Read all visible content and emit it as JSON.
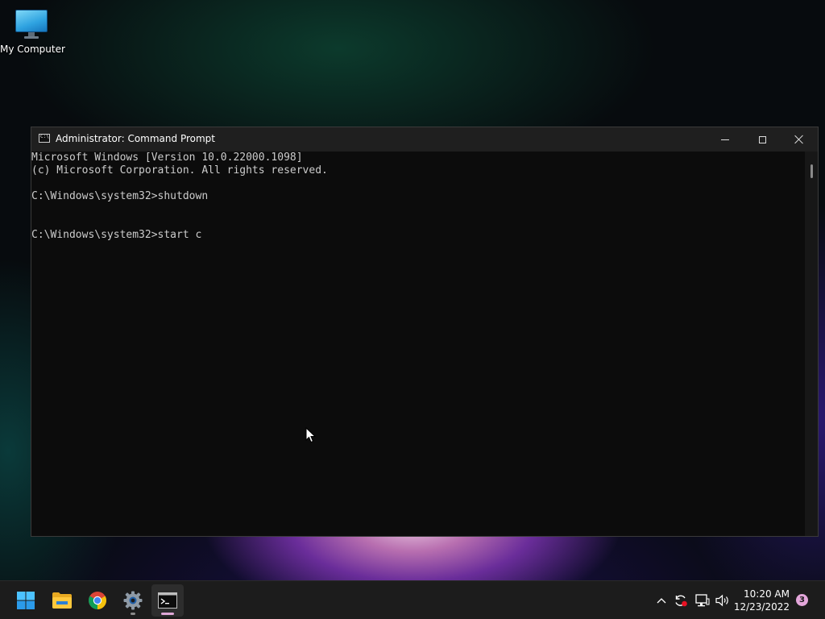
{
  "desktop": {
    "icons": [
      {
        "label": "My Computer",
        "icon": "monitor-icon"
      }
    ]
  },
  "window": {
    "title": "Administrator: Command Prompt",
    "icon": "cmd-icon",
    "controls": {
      "minimize": "minimize-icon",
      "maximize": "maximize-icon",
      "close": "close-icon"
    },
    "console_lines": [
      "Microsoft Windows [Version 10.0.22000.1098]",
      "(c) Microsoft Corporation. All rights reserved.",
      "",
      "C:\\Windows\\system32>shutdown",
      "",
      "",
      "C:\\Windows\\system32>start c"
    ],
    "colors": {
      "background": "#0c0c0c",
      "text": "#cccccc",
      "titlebar": "#1f1f1f"
    }
  },
  "taskbar": {
    "apps": [
      {
        "name": "Start",
        "icon": "windows-start-icon"
      },
      {
        "name": "File Explorer",
        "icon": "folder-icon"
      },
      {
        "name": "Google Chrome",
        "icon": "chrome-icon"
      },
      {
        "name": "Settings",
        "icon": "gear-icon"
      },
      {
        "name": "Command Prompt",
        "icon": "cmd-icon"
      }
    ],
    "tray": {
      "icons": [
        "chevron-up-icon",
        "sync-icon",
        "network-icon",
        "volume-icon"
      ],
      "time": "10:20 AM",
      "date": "12/23/2022",
      "notification_count": "3"
    },
    "colors": {
      "background": "#1c1c1c",
      "accent": "#e3a6da"
    }
  }
}
